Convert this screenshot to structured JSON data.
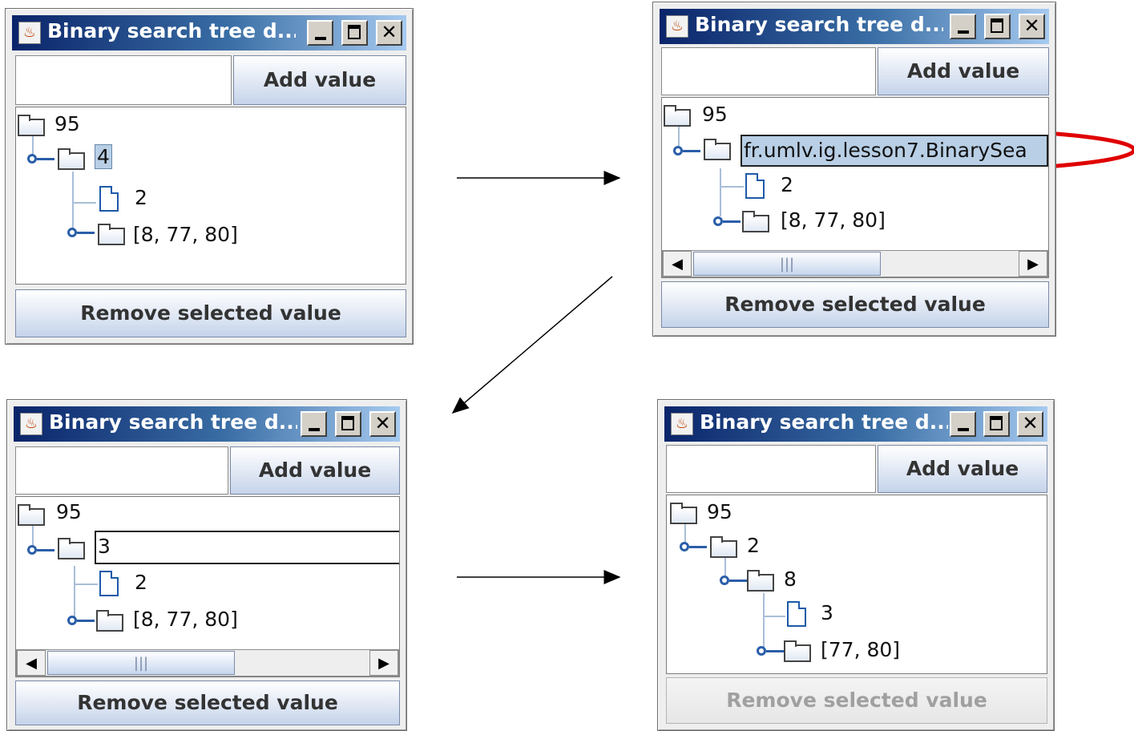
{
  "window": {
    "title": "Binary search tree d...",
    "add_value_label": "Add value",
    "remove_label": "Remove selected value"
  },
  "panel1": {
    "root": "95",
    "child": "4",
    "leaf": "2",
    "subtree": "[8, 77, 80]"
  },
  "panel2": {
    "root": "95",
    "edit_text": "fr.umlv.ig.lesson7.BinarySea",
    "leaf": "2",
    "subtree": "[8, 77, 80]",
    "scroll_thumb_glyph": "|||"
  },
  "panel3": {
    "root": "95",
    "edit_text": "3",
    "leaf": "2",
    "subtree": "[8, 77, 80]",
    "scroll_thumb_glyph": "|||"
  },
  "panel4": {
    "root": "95",
    "child": "2",
    "grandchild": "8",
    "leaf": "3",
    "subtree": "[77, 80]",
    "remove_disabled": true
  },
  "icons": {
    "app": "java-cup-icon",
    "minimize": "minimize-icon",
    "maximize": "maximize-icon",
    "close": "close-icon",
    "folder": "folder-icon",
    "leaf": "document-icon",
    "handle": "tree-handle-icon"
  },
  "colors": {
    "highlight_ellipse": "#e00000",
    "selection": "#b8cfe5",
    "title_start": "#0a246a",
    "title_end": "#a6caf0"
  }
}
